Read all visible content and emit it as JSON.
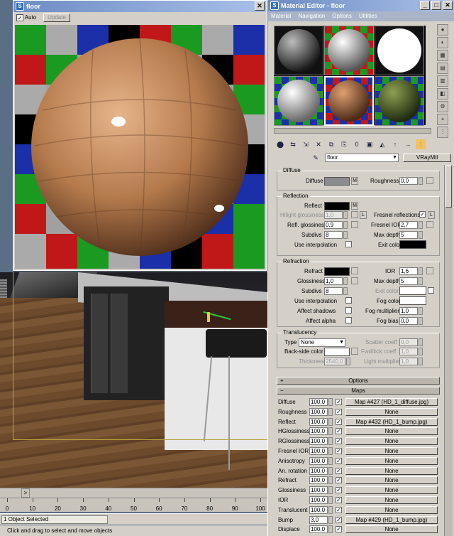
{
  "render_window": {
    "title": "floor",
    "auto_label": "Auto",
    "auto_checked": true,
    "update_label": "Update"
  },
  "material_editor": {
    "title": "Material Editor - floor",
    "menu": [
      "Material",
      "Navigation",
      "Options",
      "Utilities"
    ],
    "material_name": "floor",
    "material_type": "VRayMtl",
    "diffuse": {
      "group": "Diffuse",
      "diffuse_label": "Diffuse",
      "m_label": "M",
      "roughness_label": "Roughness",
      "roughness": "0,0",
      "diffuse_color": "#8c8c8c"
    },
    "reflection": {
      "group": "Reflection",
      "reflect_label": "Reflect",
      "m_label": "M",
      "hilight_label": "Hilight glossiness",
      "hilight": "1,0",
      "l_label": "L",
      "fresnel_label": "Fresnel reflections",
      "fresnel_checked": true,
      "l2_label": "L",
      "refl_gloss_label": "Refl. glossiness",
      "refl_gloss": "0,9",
      "fresnel_ior_label": "Fresnel IOR",
      "fresnel_ior": "2,7",
      "subdivs_label": "Subdivs",
      "subdivs": "8",
      "max_depth_label": "Max depth",
      "max_depth": "5",
      "use_interp_label": "Use interpolation",
      "exit_color_label": "Exit color"
    },
    "refraction": {
      "group": "Refraction",
      "refract_label": "Refract",
      "ior_label": "IOR",
      "ior": "1,6",
      "glossiness_label": "Glossiness",
      "glossiness": "1,0",
      "max_depth_label": "Max depth",
      "max_depth": "5",
      "subdivs_label": "Subdivs",
      "subdivs": "8",
      "exit_color_label": "Exit color",
      "use_interp_label": "Use interpolation",
      "fog_color_label": "Fog color",
      "affect_shadows_label": "Affect shadows",
      "fog_mult_label": "Fog multiplier",
      "fog_mult": "1,0",
      "affect_alpha_label": "Affect alpha",
      "fog_bias_label": "Fog bias",
      "fog_bias": "0,0"
    },
    "translucency": {
      "group": "Translucency",
      "type_label": "Type",
      "type_value": "None",
      "scatter_label": "Scatter coeff",
      "scatter": "0,0",
      "backside_label": "Back-side color",
      "fwd_bck_label": "Fwd/bck coeff",
      "fwd_bck": "1,0",
      "thickness_label": "Thickness",
      "thickness": "2540,0",
      "light_mult_label": "Light multiplier",
      "light_mult": "1,0"
    },
    "options_rollout": "Options",
    "maps_rollout": "Maps",
    "maps": [
      {
        "label": "Diffuse",
        "value": "100,0",
        "map": "Map #427 (HD_1_diffuse.jpg)"
      },
      {
        "label": "Roughness",
        "value": "100,0",
        "map": "None"
      },
      {
        "label": "Reflect",
        "value": "100,0",
        "map": "Map #432 (HD_1_bump.jpg)"
      },
      {
        "label": "HGlossiness",
        "value": "100,0",
        "map": "None"
      },
      {
        "label": "RGlossiness",
        "value": "100,0",
        "map": "None"
      },
      {
        "label": "Fresnel IOR",
        "value": "100,0",
        "map": "None"
      },
      {
        "label": "Anisotropy",
        "value": "100,0",
        "map": "None"
      },
      {
        "label": "An. rotation",
        "value": "100,0",
        "map": "None"
      },
      {
        "label": "Refract",
        "value": "100,0",
        "map": "None"
      },
      {
        "label": "Glossiness",
        "value": "100,0",
        "map": "None"
      },
      {
        "label": "IOR",
        "value": "100,0",
        "map": "None"
      },
      {
        "label": "Translucent",
        "value": "100,0",
        "map": "None"
      },
      {
        "label": "Bump",
        "value": "3,0",
        "map": "Map #429 (HD_1_bump.jpg)"
      },
      {
        "label": "Displace",
        "value": "100,0",
        "map": "None"
      }
    ]
  },
  "timeline": {
    "ticks": [
      "0",
      "10",
      "20",
      "30",
      "40",
      "50",
      "60",
      "70",
      "80",
      "90",
      "100"
    ]
  },
  "status": {
    "selection": "1 Object Selected",
    "prompt": "Click and drag to select and move objects"
  }
}
